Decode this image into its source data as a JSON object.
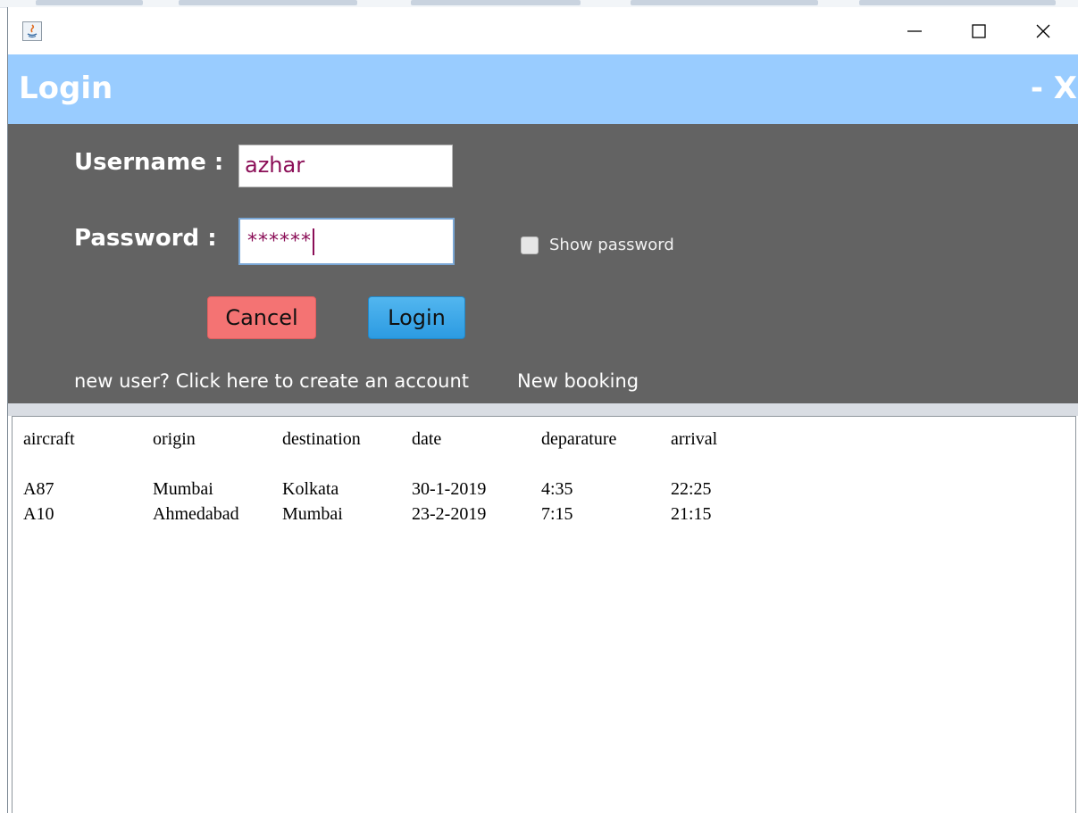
{
  "header": {
    "title": "Login",
    "minimize": "-",
    "close": "X"
  },
  "form": {
    "username_label": "Username :",
    "username_value": "azhar",
    "password_label": "Password :",
    "password_value": "******",
    "show_password_label": "Show password",
    "show_password_checked": false,
    "cancel_label": "Cancel",
    "login_label": "Login",
    "new_user_link": "new user? Click here to create an account",
    "new_booking_link": "New booking"
  },
  "table": {
    "headers": [
      "aircraft",
      "origin",
      "destination",
      "date",
      "deparature",
      "arrival"
    ],
    "rows": [
      [
        "A87",
        "Mumbai",
        "Kolkata",
        "30-1-2019",
        "4:35",
        "22:25"
      ],
      [
        "A10",
        "Ahmedabad",
        "Mumbai",
        "23-2-2019",
        "7:15",
        "21:15"
      ]
    ]
  },
  "colors": {
    "header_bg": "#99ccff",
    "panel_bg": "#636363",
    "cancel_bg": "#f47373",
    "login_bg": "#2c9be2",
    "input_text": "#8b0e57"
  },
  "icons": {
    "app": "java-icon",
    "minimize": "minimize-icon",
    "maximize": "maximize-icon",
    "close": "close-icon"
  }
}
